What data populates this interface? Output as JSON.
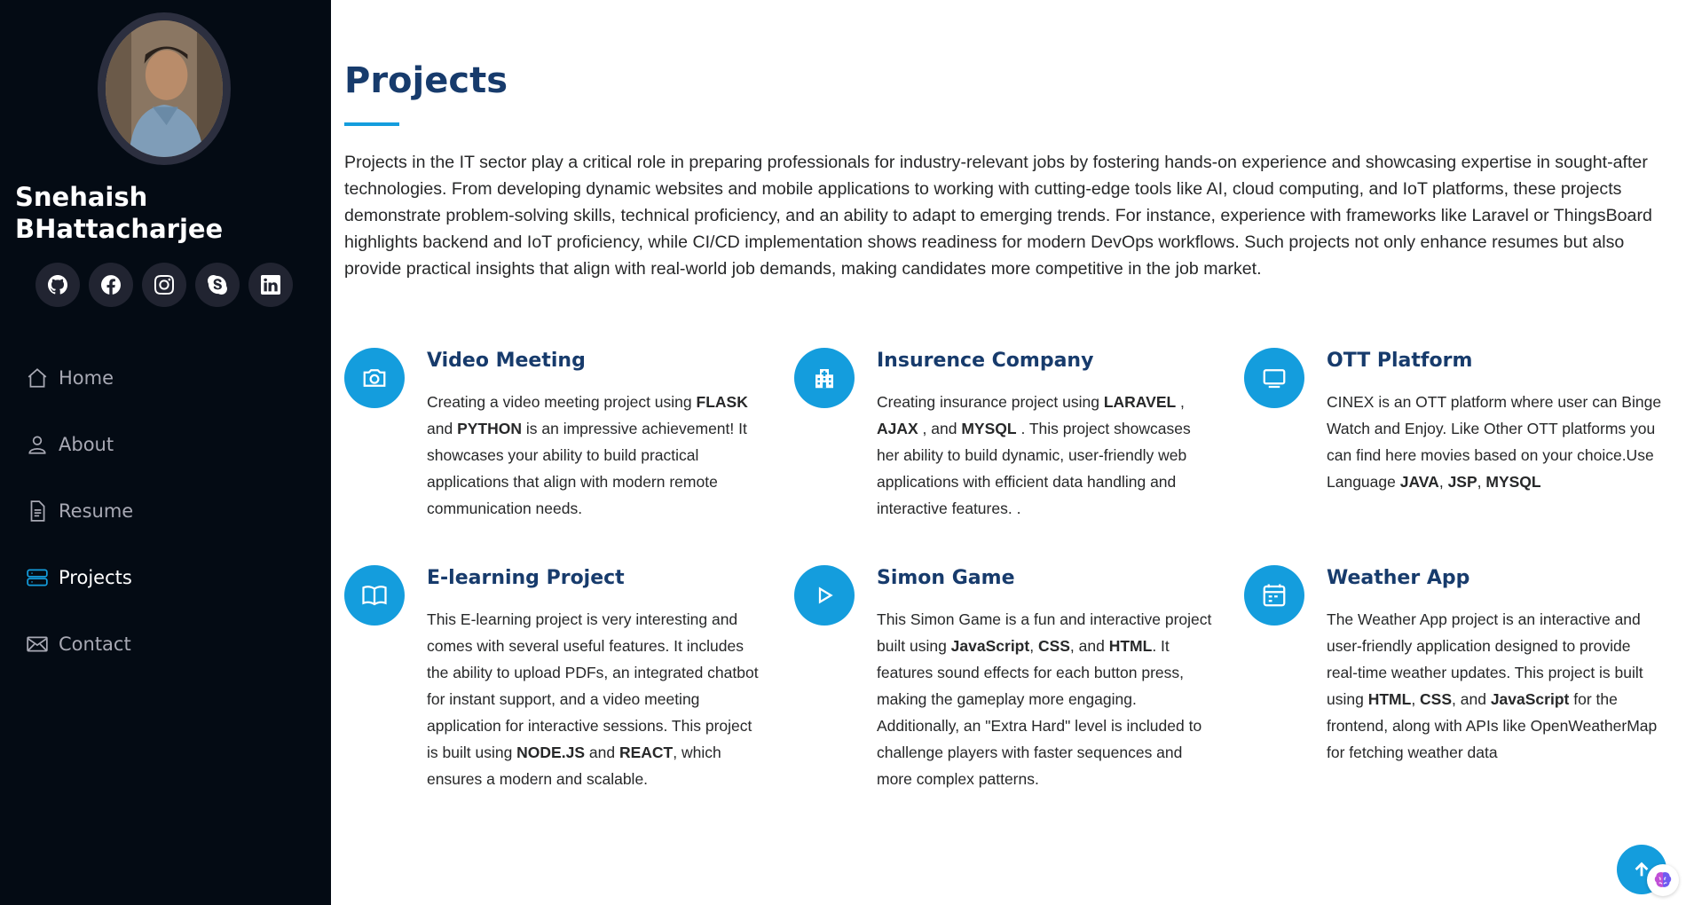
{
  "profile": {
    "name": "Snehaish BHattacharjee"
  },
  "social": [
    {
      "icon": "github-icon"
    },
    {
      "icon": "facebook-icon"
    },
    {
      "icon": "instagram-icon"
    },
    {
      "icon": "skype-icon"
    },
    {
      "icon": "linkedin-icon"
    }
  ],
  "nav": [
    {
      "label": "Home",
      "icon": "house-icon",
      "active": false
    },
    {
      "label": "About",
      "icon": "person-icon",
      "active": false
    },
    {
      "label": "Resume",
      "icon": "file-icon",
      "active": false
    },
    {
      "label": "Projects",
      "icon": "server-icon",
      "active": true
    },
    {
      "label": "Contact",
      "icon": "envelope-icon",
      "active": false
    }
  ],
  "section": {
    "title": "Projects",
    "intro": "Projects in the IT sector play a critical role in preparing professionals for industry-relevant jobs by fostering hands-on experience and showcasing expertise in sought-after technologies. From developing dynamic websites and mobile applications to working with cutting-edge tools like AI, cloud computing, and IoT platforms, these projects demonstrate problem-solving skills, technical proficiency, and an ability to adapt to emerging trends. For instance, experience with frameworks like Laravel or ThingsBoard highlights backend and IoT proficiency, while CI/CD implementation shows readiness for modern DevOps workflows. Such projects not only enhance resumes but also provide practical insights that align with real-world job demands, making candidates more competitive in the job market."
  },
  "projects": [
    {
      "title": "Video Meeting",
      "icon": "camera-icon",
      "desc": [
        {
          "t": "Creating a video meeting project using "
        },
        {
          "t": "FLASK",
          "b": true
        },
        {
          "t": " and "
        },
        {
          "t": "PYTHON",
          "b": true
        },
        {
          "t": " is an impressive achievement! It showcases your ability to build practical applications that align with modern remote communication needs."
        }
      ]
    },
    {
      "title": "Insurence Company",
      "icon": "hospital-icon",
      "desc": [
        {
          "t": "Creating insurance project using "
        },
        {
          "t": "LARAVEL",
          "b": true
        },
        {
          "t": " , "
        },
        {
          "t": "AJAX",
          "b": true
        },
        {
          "t": " , and "
        },
        {
          "t": "MYSQL",
          "b": true
        },
        {
          "t": " . This project showcases her ability to build dynamic, user-friendly web applications with efficient data handling and interactive features. ."
        }
      ]
    },
    {
      "title": "OTT Platform",
      "icon": "tv-icon",
      "desc": [
        {
          "t": "CINEX is an OTT platform where user can Binge Watch and Enjoy. Like Other OTT platforms you can find here movies based on your choice.Use Language "
        },
        {
          "t": "JAVA",
          "b": true
        },
        {
          "t": ", "
        },
        {
          "t": "JSP",
          "b": true
        },
        {
          "t": ", "
        },
        {
          "t": "MYSQL",
          "b": true
        }
      ]
    },
    {
      "title": "E-learning Project",
      "icon": "book-icon",
      "desc": [
        {
          "t": "This E-learning project is very interesting and comes with several useful features. It includes the ability to upload PDFs, an integrated chatbot for instant support, and a video meeting application for interactive sessions. This project is built using "
        },
        {
          "t": "NODE.JS",
          "b": true
        },
        {
          "t": " and "
        },
        {
          "t": "REACT",
          "b": true
        },
        {
          "t": ", which ensures a modern and scalable."
        }
      ]
    },
    {
      "title": "Simon Game",
      "icon": "play-icon",
      "desc": [
        {
          "t": "This Simon Game is a fun and interactive project built using "
        },
        {
          "t": "JavaScript",
          "b": true
        },
        {
          "t": ", "
        },
        {
          "t": "CSS",
          "b": true
        },
        {
          "t": ", and "
        },
        {
          "t": "HTML",
          "b": true
        },
        {
          "t": ". It features sound effects for each button press, making the gameplay more engaging. Additionally, an \"Extra Hard\" level is included to challenge players with faster sequences and more complex patterns."
        }
      ]
    },
    {
      "title": "Weather App",
      "icon": "calendar-icon",
      "desc": [
        {
          "t": "The Weather App project is an interactive and user-friendly application designed to provide real-time weather updates. This project is built using "
        },
        {
          "t": "HTML",
          "b": true
        },
        {
          "t": ", "
        },
        {
          "t": "CSS",
          "b": true
        },
        {
          "t": ", and "
        },
        {
          "t": "JavaScript",
          "b": true
        },
        {
          "t": " for the frontend, along with APIs like OpenWeatherMap for fetching weather data"
        }
      ]
    }
  ],
  "widgets": {
    "back_to_top_icon": "arrow-up-icon",
    "assistant_icon": "brain-icon"
  },
  "colors": {
    "sidebar_bg": "#040b14",
    "accent": "#149ddd",
    "heading": "#173b6c",
    "nav_text": "#a8a9b4"
  }
}
